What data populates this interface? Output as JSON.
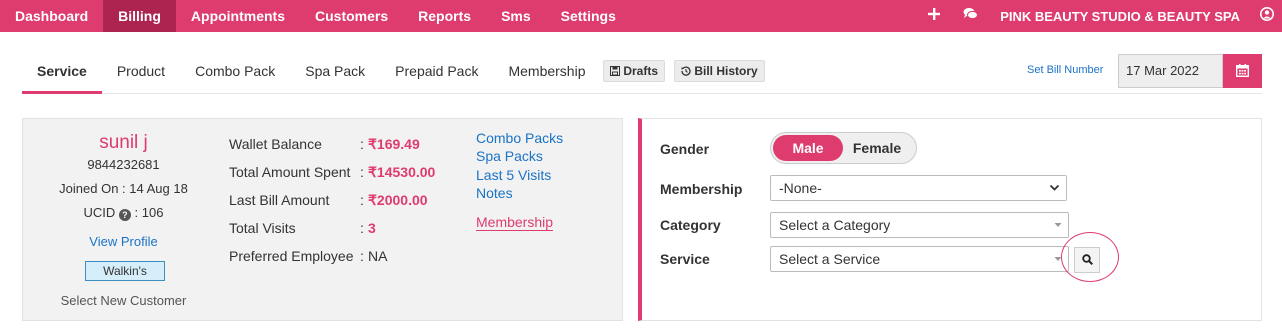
{
  "nav": {
    "items": [
      "Dashboard",
      "Billing",
      "Appointments",
      "Customers",
      "Reports",
      "Sms",
      "Settings"
    ],
    "active": "Billing",
    "salon_name": "PINK BEAUTY STUDIO & BEAUTY SPA",
    "icons": [
      "plus-icon",
      "chat-icon",
      "user-icon"
    ]
  },
  "tabs": {
    "items": [
      "Service",
      "Product",
      "Combo Pack",
      "Spa Pack",
      "Prepaid Pack",
      "Membership"
    ],
    "active": "Service",
    "drafts_label": "Drafts",
    "bill_history_label": "Bill History",
    "set_bill_number": "Set Bill Number",
    "date": "17 Mar 2022"
  },
  "customer": {
    "name": "sunil j",
    "phone": "9844232681",
    "joined": "Joined On : 14 Aug 18",
    "ucid_label": "UCID",
    "ucid_value": ": 106",
    "view_profile": "View Profile",
    "tag": "Walkin's",
    "select_new": "Select New Customer"
  },
  "stats": {
    "wallet_label": "Wallet Balance",
    "wallet_value": "169.49",
    "spent_label": "Total Amount Spent",
    "spent_value": "14530.00",
    "last_bill_label": "Last Bill Amount",
    "last_bill_value": "2000.00",
    "visits_label": "Total Visits",
    "visits_value": "3",
    "employee_label": "Preferred Employee",
    "employee_value": "NA",
    "colon": ":",
    "currency": "₹"
  },
  "links": {
    "combo_packs": "Combo Packs",
    "spa_packs": "Spa Packs",
    "last_visits": "Last 5 Visits",
    "notes": "Notes",
    "membership": "Membership"
  },
  "form": {
    "gender_label": "Gender",
    "gender_male": "Male",
    "gender_female": "Female",
    "gender_selected": "Male",
    "membership_label": "Membership",
    "membership_value": "-None-",
    "category_label": "Category",
    "category_placeholder": "Select a Category",
    "service_label": "Service",
    "service_placeholder": "Select a Service"
  },
  "colors": {
    "brand": "#de3b6e",
    "brand_dark": "#ad2451",
    "link": "#1b73c6"
  }
}
